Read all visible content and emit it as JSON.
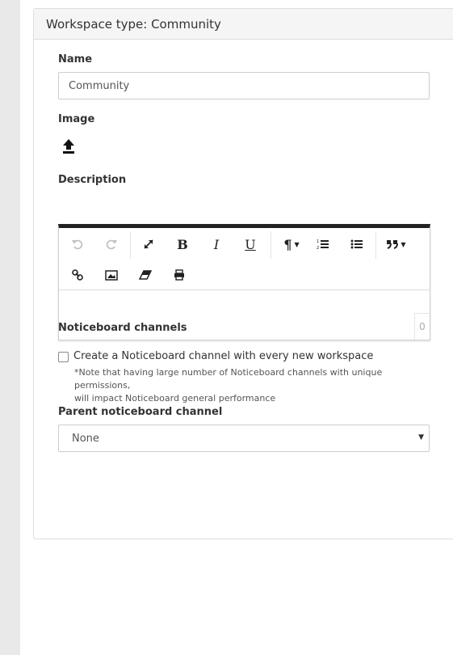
{
  "panel": {
    "heading": "Workspace type: Community"
  },
  "form": {
    "name": {
      "label": "Name",
      "value": "Community"
    },
    "image": {
      "label": "Image",
      "upload_icon": "upload-icon"
    },
    "description": {
      "label": "Description",
      "toolbar": [
        {
          "name": "undo-icon",
          "state": "disabled"
        },
        {
          "name": "redo-icon",
          "state": "disabled"
        },
        {
          "name": "fullscreen-icon"
        },
        {
          "name": "bold-icon",
          "text": "B"
        },
        {
          "name": "italic-icon",
          "text": "I"
        },
        {
          "name": "underline-icon",
          "text": "U"
        },
        {
          "name": "paragraph-dropdown-icon",
          "text": "¶"
        },
        {
          "name": "ordered-list-icon"
        },
        {
          "name": "unordered-list-icon"
        },
        {
          "name": "quote-dropdown-icon"
        },
        {
          "name": "link-icon"
        },
        {
          "name": "image-icon"
        },
        {
          "name": "eraser-icon"
        },
        {
          "name": "print-icon"
        }
      ],
      "char_count": "0"
    },
    "noticeboard": {
      "label": "Noticeboard channels",
      "checkbox_label": "Create a Noticeboard channel with every new workspace",
      "checked": false,
      "note_line1": "*Note that having large number of Noticeboard channels with unique permissions,",
      "note_line2": "will impact Noticeboard general performance"
    },
    "parent_channel": {
      "label": "Parent noticeboard channel",
      "selected": "None"
    }
  },
  "colors": {
    "toolbar_top_border": "#222222",
    "panel_heading_bg": "#f5f5f5",
    "rail_bg": "#e9e9e9"
  }
}
